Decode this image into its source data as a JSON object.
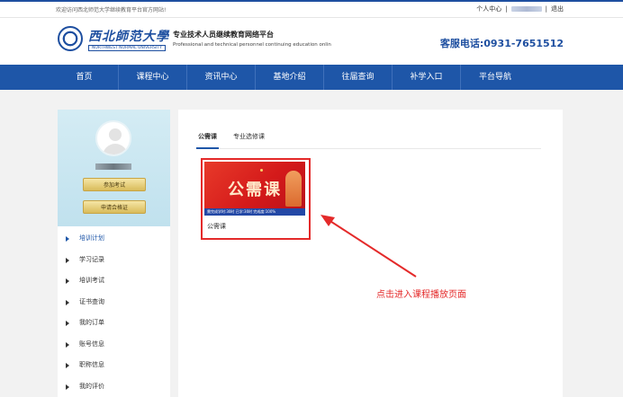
{
  "topbar": {
    "welcome": "欢迎访问西北师范大学继续教育平台官方网站!",
    "user_center": "个人中心",
    "separator": "|",
    "logout": "退出"
  },
  "header": {
    "logo_text": "西北師范大學",
    "logo_sub": "NORTHWEST NORMAL UNIVERSITY",
    "platform_title": "专业技术人员继续教育网络平台",
    "platform_sub": "Professional and technical personnel continuing education onlin",
    "hotline": "客服电话:0931-7651512"
  },
  "nav": {
    "items": [
      {
        "label": "首页"
      },
      {
        "label": "课程中心"
      },
      {
        "label": "资讯中心"
      },
      {
        "label": "基地介绍"
      },
      {
        "label": "往届查询"
      },
      {
        "label": "补学入口"
      },
      {
        "label": "平台导航"
      }
    ]
  },
  "sidebar": {
    "exam_button": "参加考试",
    "cert_button": "申请合格证",
    "menu": [
      {
        "label": "培训计划",
        "active": true
      },
      {
        "label": "学习记录"
      },
      {
        "label": "培训考试"
      },
      {
        "label": "证书查询"
      },
      {
        "label": "我的订单"
      },
      {
        "label": "账号信息"
      },
      {
        "label": "职称信息"
      },
      {
        "label": "我的评价"
      }
    ]
  },
  "main": {
    "tabs": [
      {
        "label": "公需课",
        "active": true
      },
      {
        "label": "专业选修课"
      }
    ],
    "course": {
      "thumb_title": "公需课",
      "stats": "需完成学时:30时 已学:30时 完成度:100%",
      "name": "公需课"
    }
  },
  "annotation": {
    "text": "点击进入课程播放页面",
    "color": "#e42a2a"
  },
  "colors": {
    "brand_blue": "#1e56a8",
    "accent_red": "#e42a2a"
  }
}
